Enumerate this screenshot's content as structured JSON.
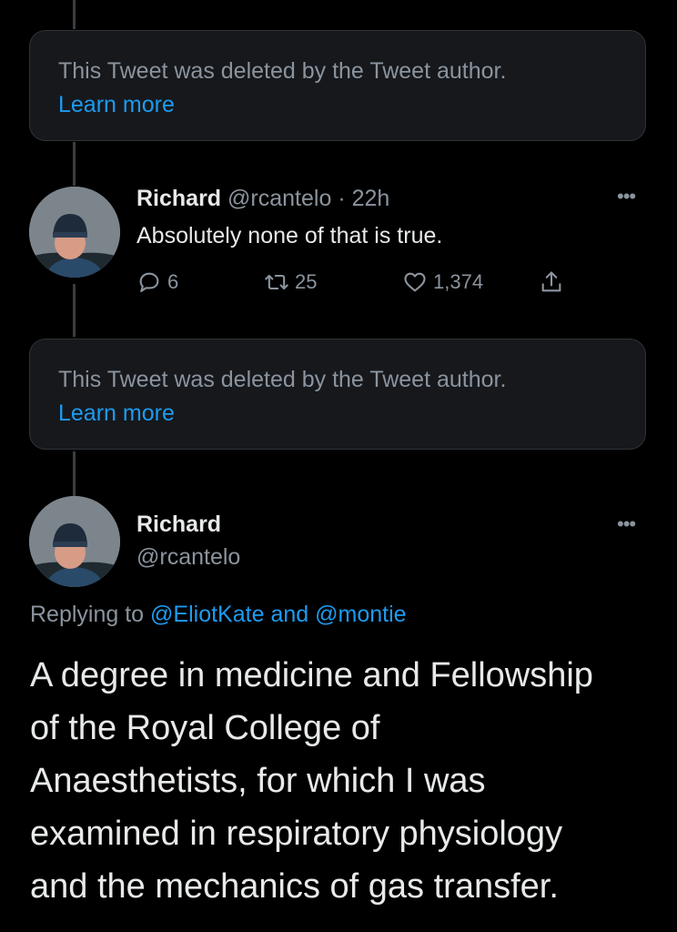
{
  "deleted_notice": {
    "text": "This Tweet was deleted by the Tweet author.",
    "link": "Learn more"
  },
  "tweet_1": {
    "name": "Richard",
    "handle": "@rcantelo",
    "separator": "·",
    "time": "22h",
    "text": "Absolutely none of that is true.",
    "replies": "6",
    "retweets": "25",
    "likes": "1,374",
    "more_icon": "more-horizontal-icon"
  },
  "tweet_2": {
    "name": "Richard",
    "handle": "@rcantelo",
    "replying_prefix": "Replying to",
    "mention_1": "@EliotKate",
    "replying_and": "and",
    "mention_2": "@montie",
    "text_lines": [
      "A degree in medicine and Fellowship",
      "of the Royal College of",
      "Anaesthetists, for which I was",
      "examined in respiratory physiology",
      "and the mechanics of gas transfer."
    ],
    "more_icon": "more-horizontal-icon"
  },
  "colors": {
    "background": "#000000",
    "card": "#16181c",
    "accent": "#1d9bf0",
    "muted": "#8b949e",
    "text": "#e7e9ea"
  }
}
